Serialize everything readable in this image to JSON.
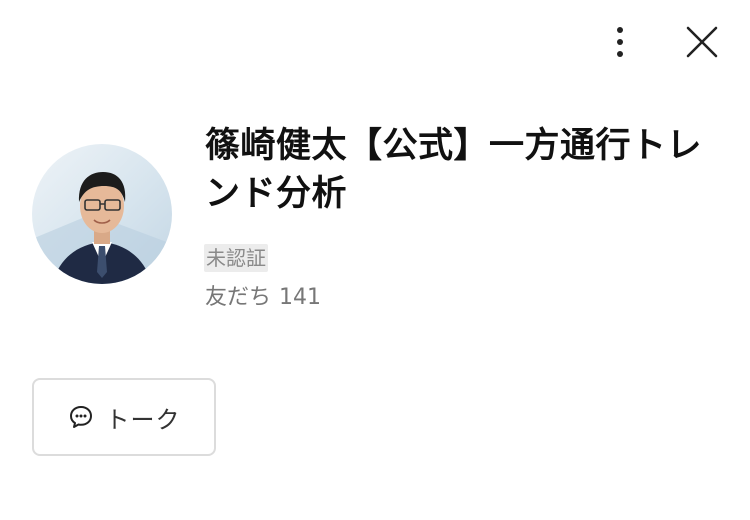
{
  "header": {
    "more_icon": "vertical-dots-icon",
    "close_icon": "close-icon"
  },
  "profile": {
    "name": "篠崎健太【公式】一方通行トレンド分析",
    "verification_badge": "未認証",
    "friends_label": "友だち",
    "friends_count": "141"
  },
  "actions": {
    "talk_label": "トーク",
    "talk_icon": "chat-bubble-icon"
  }
}
